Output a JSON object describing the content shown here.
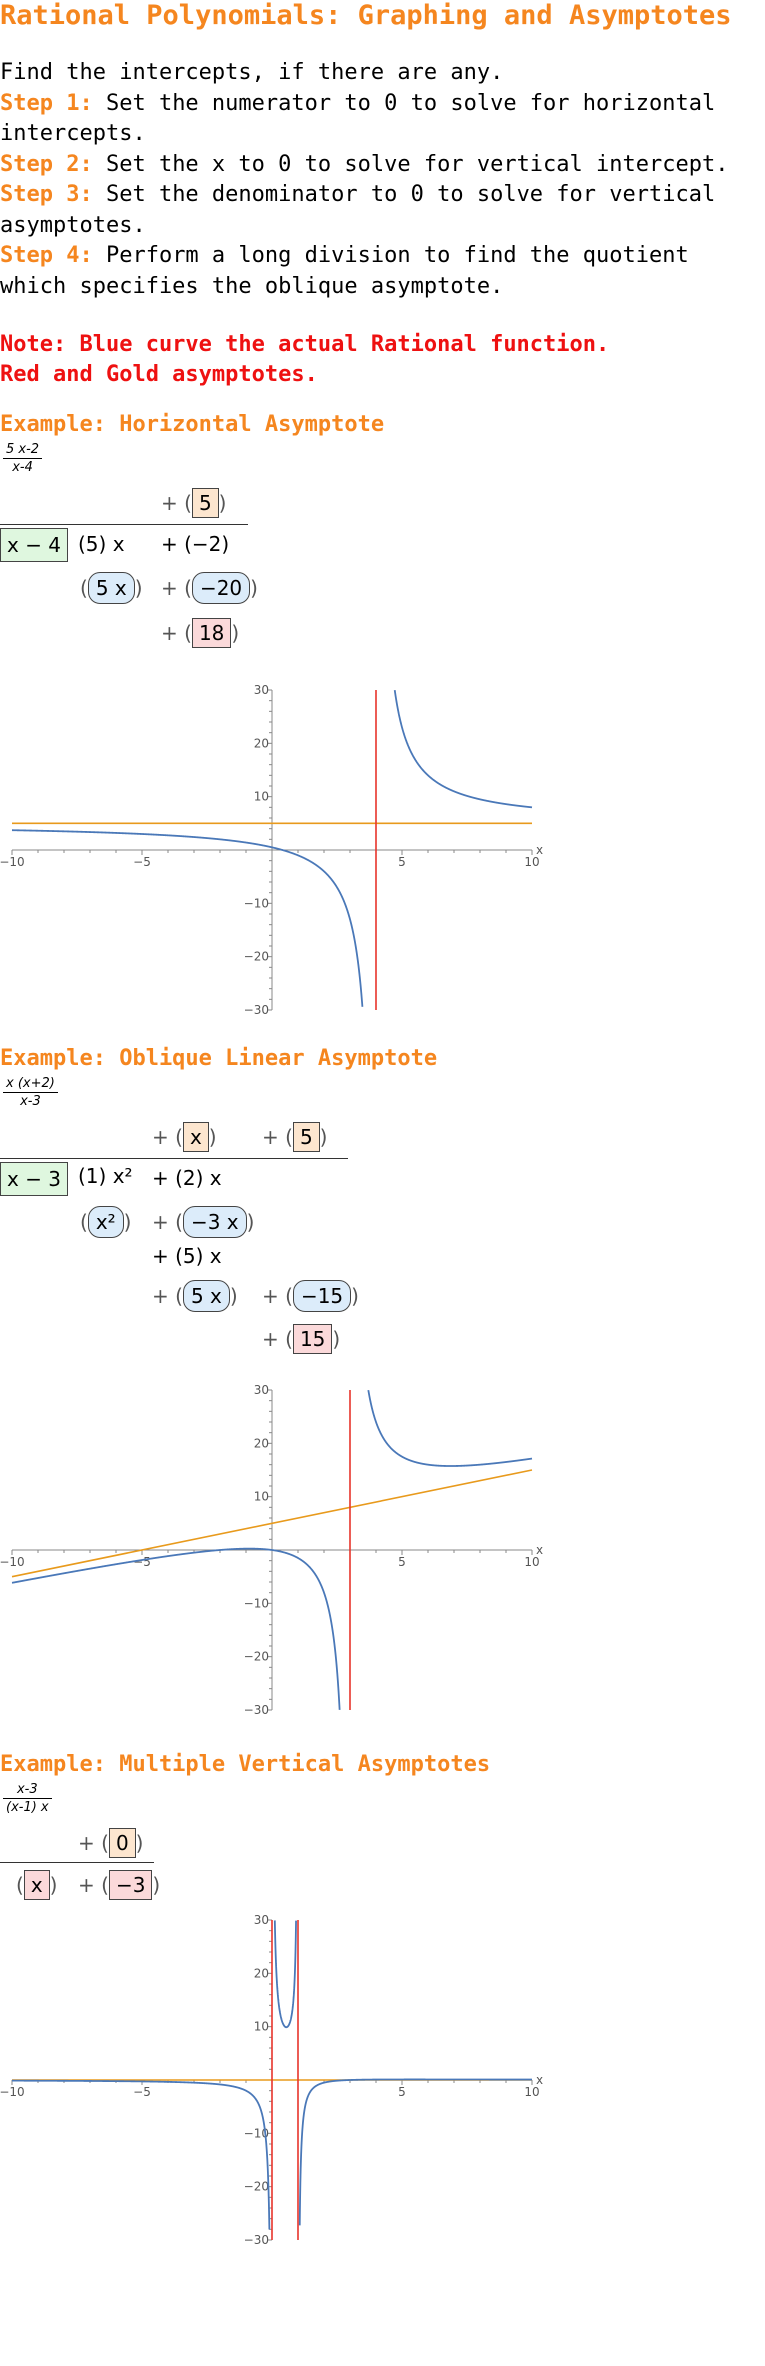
{
  "title": "Rational Polynomials: Graphing and Asymptotes",
  "intro": "Find the intercepts, if there are any.",
  "steps": [
    {
      "label": "Step 1:",
      "text": " Set the numerator to 0 to solve for horizontal intercepts."
    },
    {
      "label": "Step 2:",
      "text": " Set the x to 0 to solve for vertical intercept."
    },
    {
      "label": "Step 3:",
      "text": " Set the denominator to 0 to solve for vertical asymptotes."
    },
    {
      "label": "Step 4:",
      "text": " Perform a long division to find the quotient which specifies the oblique asymptote."
    }
  ],
  "note": [
    "Note: Blue curve the actual Rational function.",
    "Red and Gold asymptotes."
  ],
  "colors": {
    "accent_orange": "#f5861f",
    "note_red": "#ee1111",
    "curve_blue": "#4a78b8",
    "asymptote_red": "#e8342b",
    "asymptote_gold": "#e89a1c"
  },
  "examples": [
    {
      "title": "Example: Horizontal Asymptote",
      "fraction": {
        "num": "5 x-2",
        "den": "x-4"
      },
      "division": {
        "plus": "+",
        "quotient": [
          "5"
        ],
        "divisor": "x − 4",
        "dividend": [
          "(5) x",
          "+ (−2)"
        ],
        "product": [
          "5 x",
          "−20"
        ],
        "remainder": "18"
      },
      "chart_data": {
        "type": "line",
        "function": "(5x-2)/(x-4)",
        "xlim": [
          -10,
          10
        ],
        "ylim": [
          -30,
          30
        ],
        "xticks": [
          -10,
          -5,
          5,
          10
        ],
        "yticks": [
          -30,
          -20,
          -10,
          10,
          20,
          30
        ],
        "xlabel": "x",
        "ylabel": "",
        "vertical_asymptotes": [
          4
        ],
        "horizontal_asymptote": 5,
        "oblique_asymptote": null
      }
    },
    {
      "title": "Example: Oblique Linear Asymptote",
      "fraction": {
        "num": "x (x+2)",
        "den": "x-3"
      },
      "division": {
        "plus": "+",
        "quotient": [
          "x",
          "5"
        ],
        "divisor": "x − 3",
        "dividend": [
          "(1) x²",
          "+ (2) x"
        ],
        "product1": [
          "x²",
          "−3 x"
        ],
        "carry": "+ (5) x",
        "product2": [
          "5 x",
          "−15"
        ],
        "remainder": "15"
      },
      "chart_data": {
        "type": "line",
        "function": "x(x+2)/(x-3)",
        "xlim": [
          -10,
          10
        ],
        "ylim": [
          -30,
          30
        ],
        "xticks": [
          -10,
          -5,
          5,
          10
        ],
        "yticks": [
          -30,
          -20,
          -10,
          10,
          20,
          30
        ],
        "xlabel": "x",
        "ylabel": "",
        "vertical_asymptotes": [
          3
        ],
        "horizontal_asymptote": null,
        "oblique_asymptote": {
          "slope": 1,
          "intercept": 5
        }
      }
    },
    {
      "title": "Example: Multiple Vertical Asymptotes",
      "fraction": {
        "num": "x-3",
        "den": "(x-1) x"
      },
      "division": {
        "plus": "+",
        "quotient": [
          "0"
        ],
        "divisor": "x",
        "dividend": [
          "−3"
        ]
      },
      "chart_data": {
        "type": "line",
        "function": "(x-3)/((x-1)x)",
        "xlim": [
          -10,
          10
        ],
        "ylim": [
          -30,
          30
        ],
        "xticks": [
          -10,
          -5,
          5,
          10
        ],
        "yticks": [
          -30,
          -20,
          -10,
          10,
          20,
          30
        ],
        "xlabel": "x",
        "ylabel": "",
        "vertical_asymptotes": [
          0,
          1
        ],
        "horizontal_asymptote": 0,
        "oblique_asymptote": null
      }
    }
  ]
}
